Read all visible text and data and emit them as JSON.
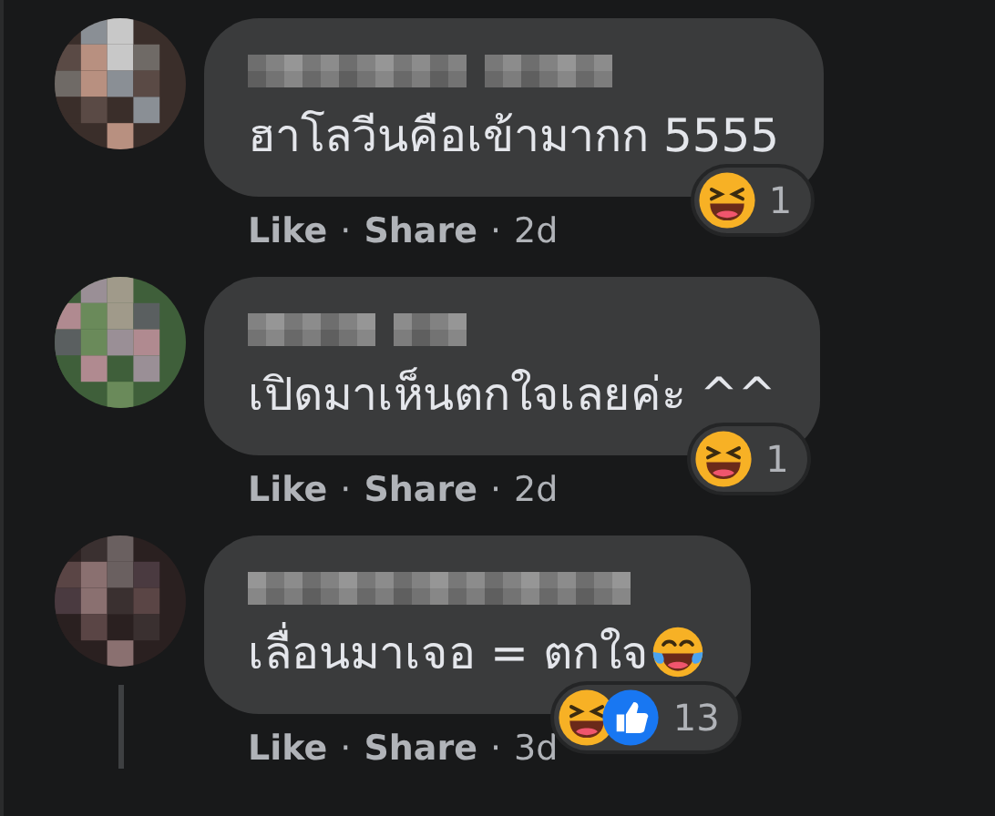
{
  "comments": [
    {
      "text": "ฮาโลวีนคือเข้ามากก 5555",
      "laughing_tears_emoji": false,
      "actions": [
        "Like",
        "Share"
      ],
      "separator": "·",
      "time": "2d",
      "reactions": [
        {
          "kind": "haha"
        }
      ],
      "reaction_count": "1",
      "thread_line": false
    },
    {
      "text": "เปิดมาเห็นตกใจเลยค่ะ ^^",
      "laughing_tears_emoji": false,
      "actions": [
        "Like",
        "Share"
      ],
      "separator": "·",
      "time": "2d",
      "reactions": [
        {
          "kind": "haha"
        }
      ],
      "reaction_count": "1",
      "thread_line": false
    },
    {
      "text": "เลื่อนมาเจอ = ตกใจ",
      "laughing_tears_emoji": true,
      "actions": [
        "Like",
        "Share"
      ],
      "separator": "·",
      "time": "3d",
      "reactions": [
        {
          "kind": "haha"
        },
        {
          "kind": "like"
        }
      ],
      "reaction_count": "13",
      "thread_line": true
    }
  ]
}
